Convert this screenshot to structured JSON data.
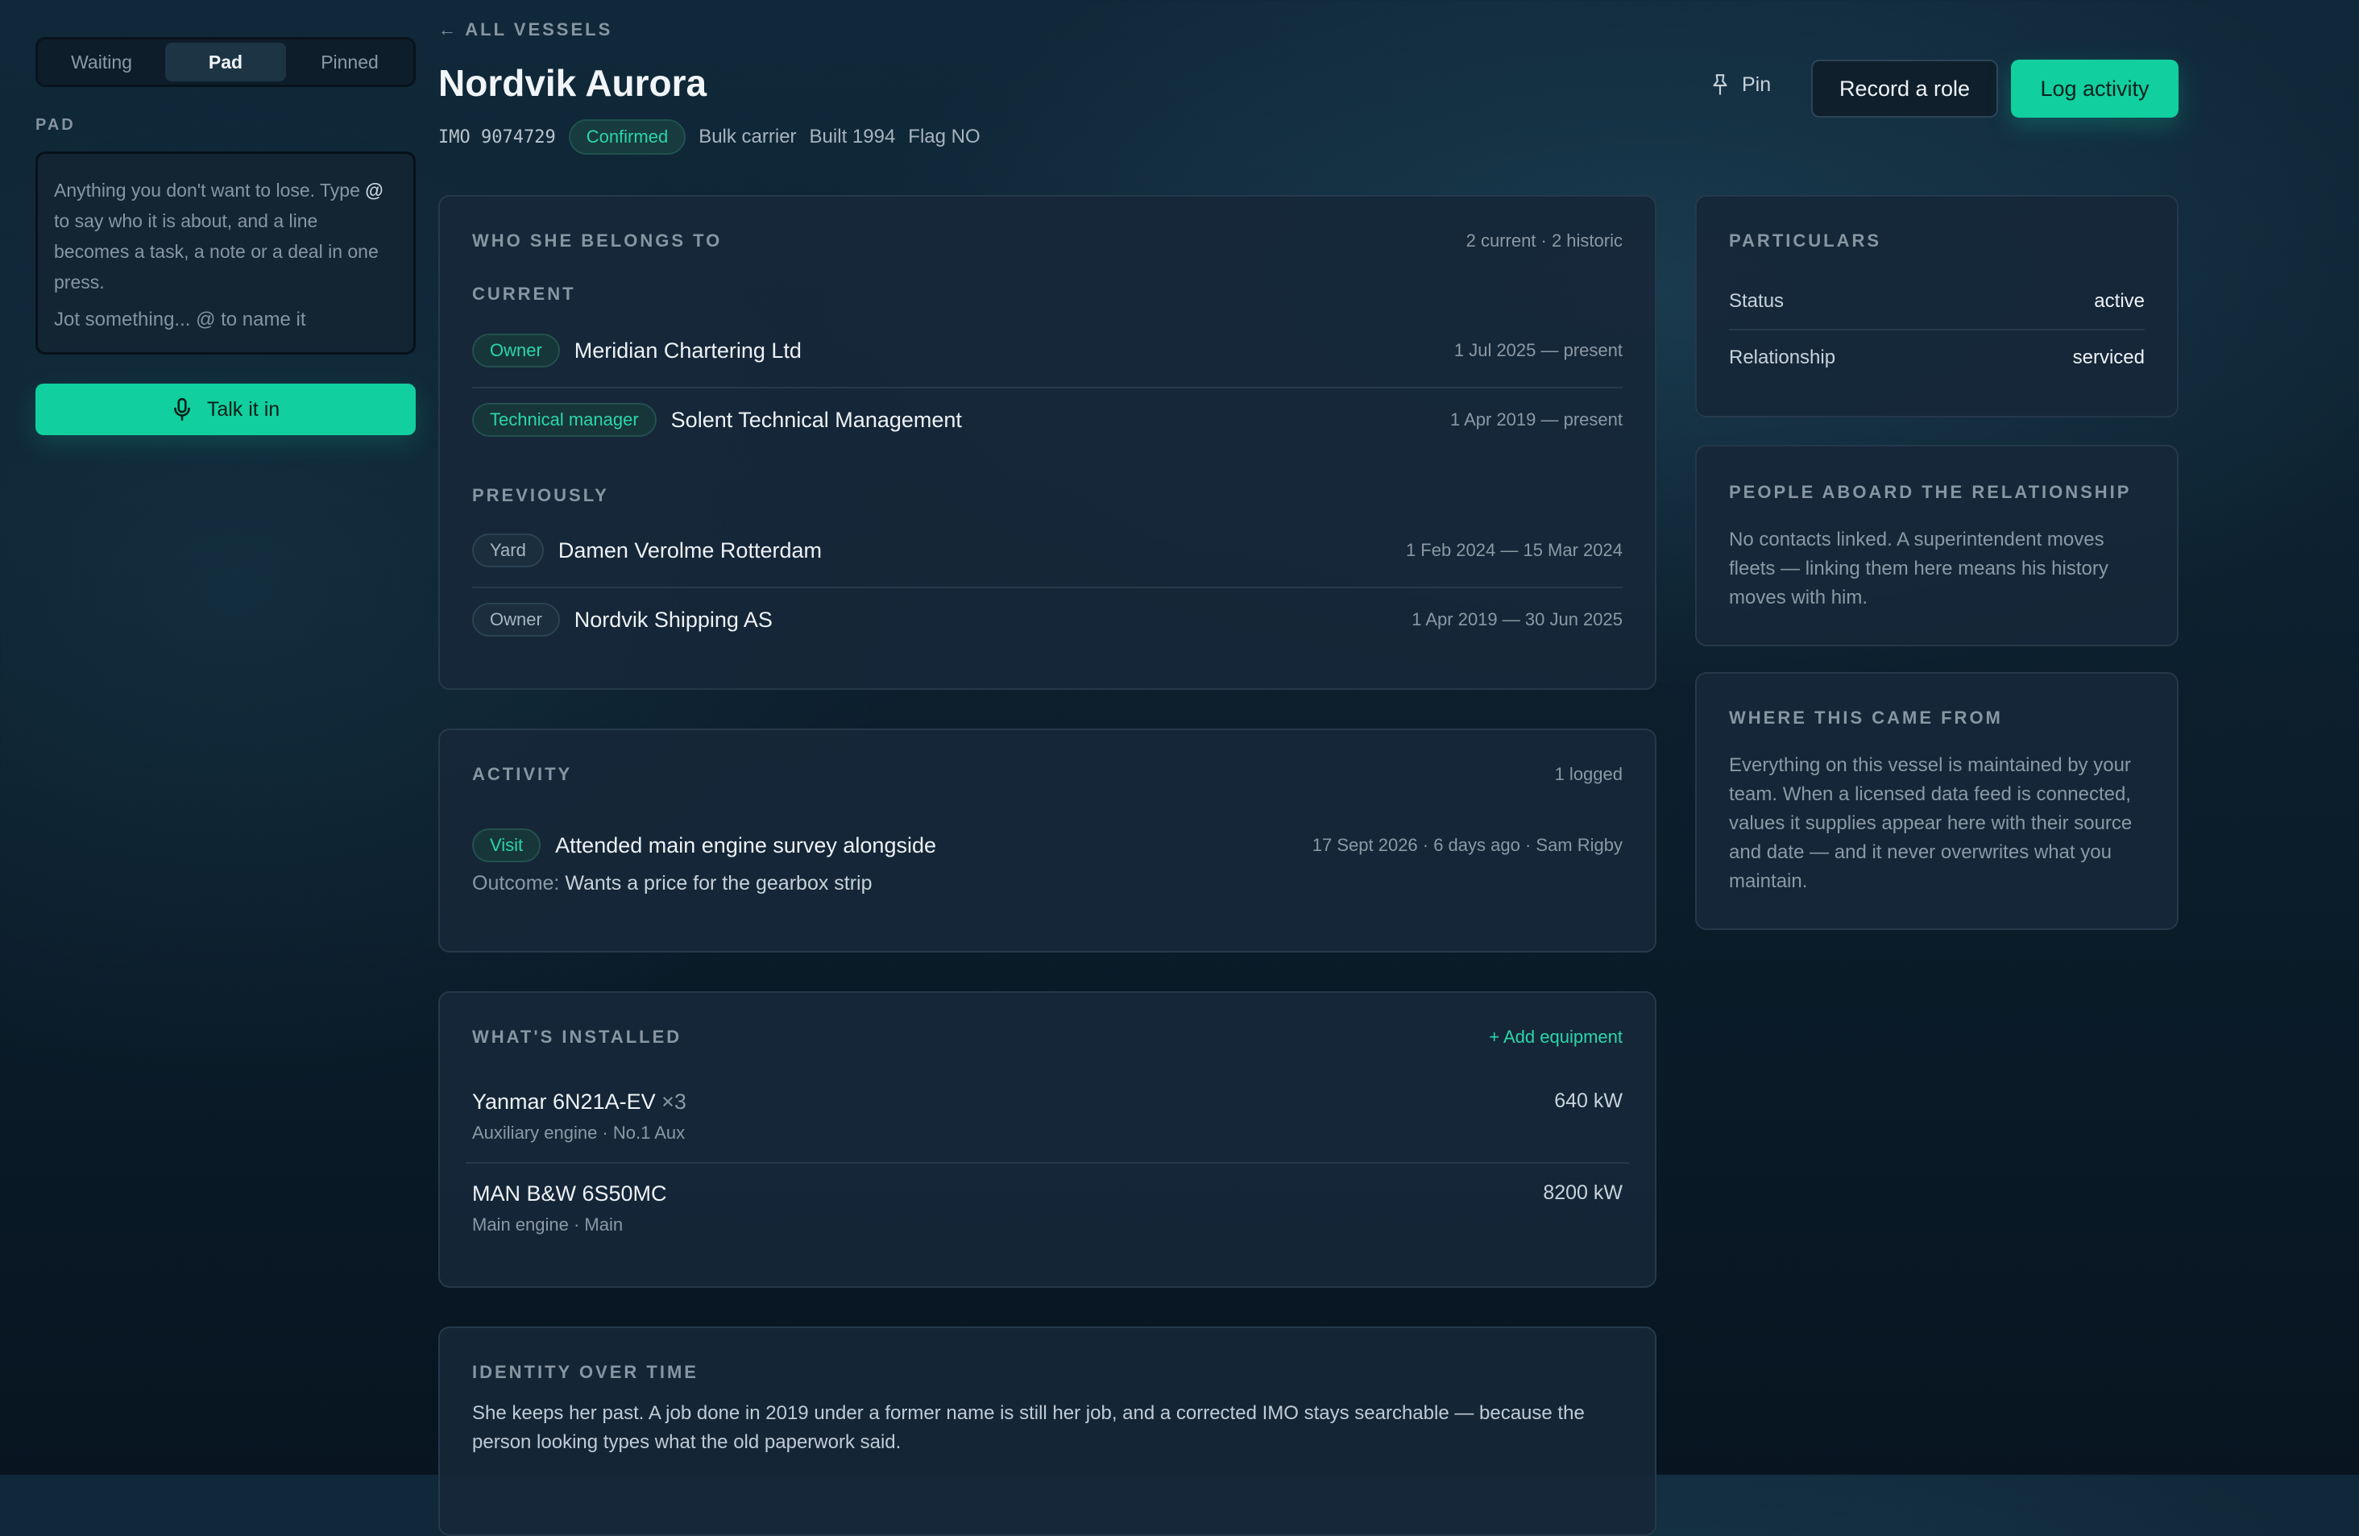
{
  "sidebar": {
    "tabs": [
      "Waiting",
      "Pad",
      "Pinned"
    ],
    "active_tab": "Pad",
    "pad_label": "PAD",
    "pad_help_1": "Anything you don't want to lose. Type",
    "pad_help_at": "@",
    "pad_help_2": "to say who it is about, and a line becomes a task, a note or a deal in one press.",
    "pad_placeholder": "Jot something... @ to name it",
    "talk_label": "Talk it in"
  },
  "header": {
    "back_label": "← ALL VESSELS",
    "title": "Nordvik Aurora",
    "imo": "IMO 9074729",
    "status": "Confirmed",
    "type": "Bulk carrier",
    "built": "Built 1994",
    "flag": "Flag NO",
    "pin_label": "Pin",
    "record_role_label": "Record a role",
    "log_activity_label": "Log activity"
  },
  "ownership": {
    "title": "WHO SHE BELONGS TO",
    "count": "2 current · 2 historic",
    "current_label": "CURRENT",
    "previous_label": "PREVIOUSLY",
    "current": [
      {
        "role": "Owner",
        "name": "Meridian Chartering Ltd",
        "dates": "1 Jul 2025 — present"
      },
      {
        "role": "Technical manager",
        "name": "Solent Technical Management",
        "dates": "1 Apr 2019 — present"
      }
    ],
    "previous": [
      {
        "role": "Yard",
        "name": "Damen Verolme Rotterdam",
        "dates": "1 Feb 2024 — 15 Mar 2024"
      },
      {
        "role": "Owner",
        "name": "Nordvik Shipping AS",
        "dates": "1 Apr 2019 — 30 Jun 2025"
      }
    ]
  },
  "activity": {
    "title": "ACTIVITY",
    "count": "1 logged",
    "items": [
      {
        "type": "Visit",
        "title": "Attended main engine survey alongside",
        "meta": "17 Sept 2026 · 6 days ago · Sam Rigby",
        "outcome_label": "Outcome:",
        "outcome": "Wants a price for the gearbox strip"
      }
    ]
  },
  "installed": {
    "title": "WHAT'S INSTALLED",
    "add_label": "+ Add equipment",
    "items": [
      {
        "name": "Yanmar 6N21A-EV",
        "qty": "×3",
        "sub": "Auxiliary engine · No.1 Aux",
        "power": "640 kW"
      },
      {
        "name": "MAN B&W 6S50MC",
        "qty": "",
        "sub": "Main engine · Main",
        "power": "8200 kW"
      }
    ]
  },
  "identity": {
    "title": "IDENTITY OVER TIME",
    "text": "She keeps her past. A job done in 2019 under a former name is still her job, and a corrected IMO stays searchable — because the person looking types what the old paperwork said."
  },
  "particulars": {
    "title": "PARTICULARS",
    "rows": [
      {
        "label": "Status",
        "value": "active"
      },
      {
        "label": "Relationship",
        "value": "serviced"
      }
    ]
  },
  "people": {
    "title": "PEOPLE ABOARD THE RELATIONSHIP",
    "text": "No contacts linked. A superintendent moves fleets — linking them here means his history moves with him."
  },
  "source": {
    "title": "WHERE THIS CAME FROM",
    "text": "Everything on this vessel is maintained by your team. When a licensed data feed is connected, values it supplies appear here with their source and date — and it never overwrites what you maintain."
  }
}
